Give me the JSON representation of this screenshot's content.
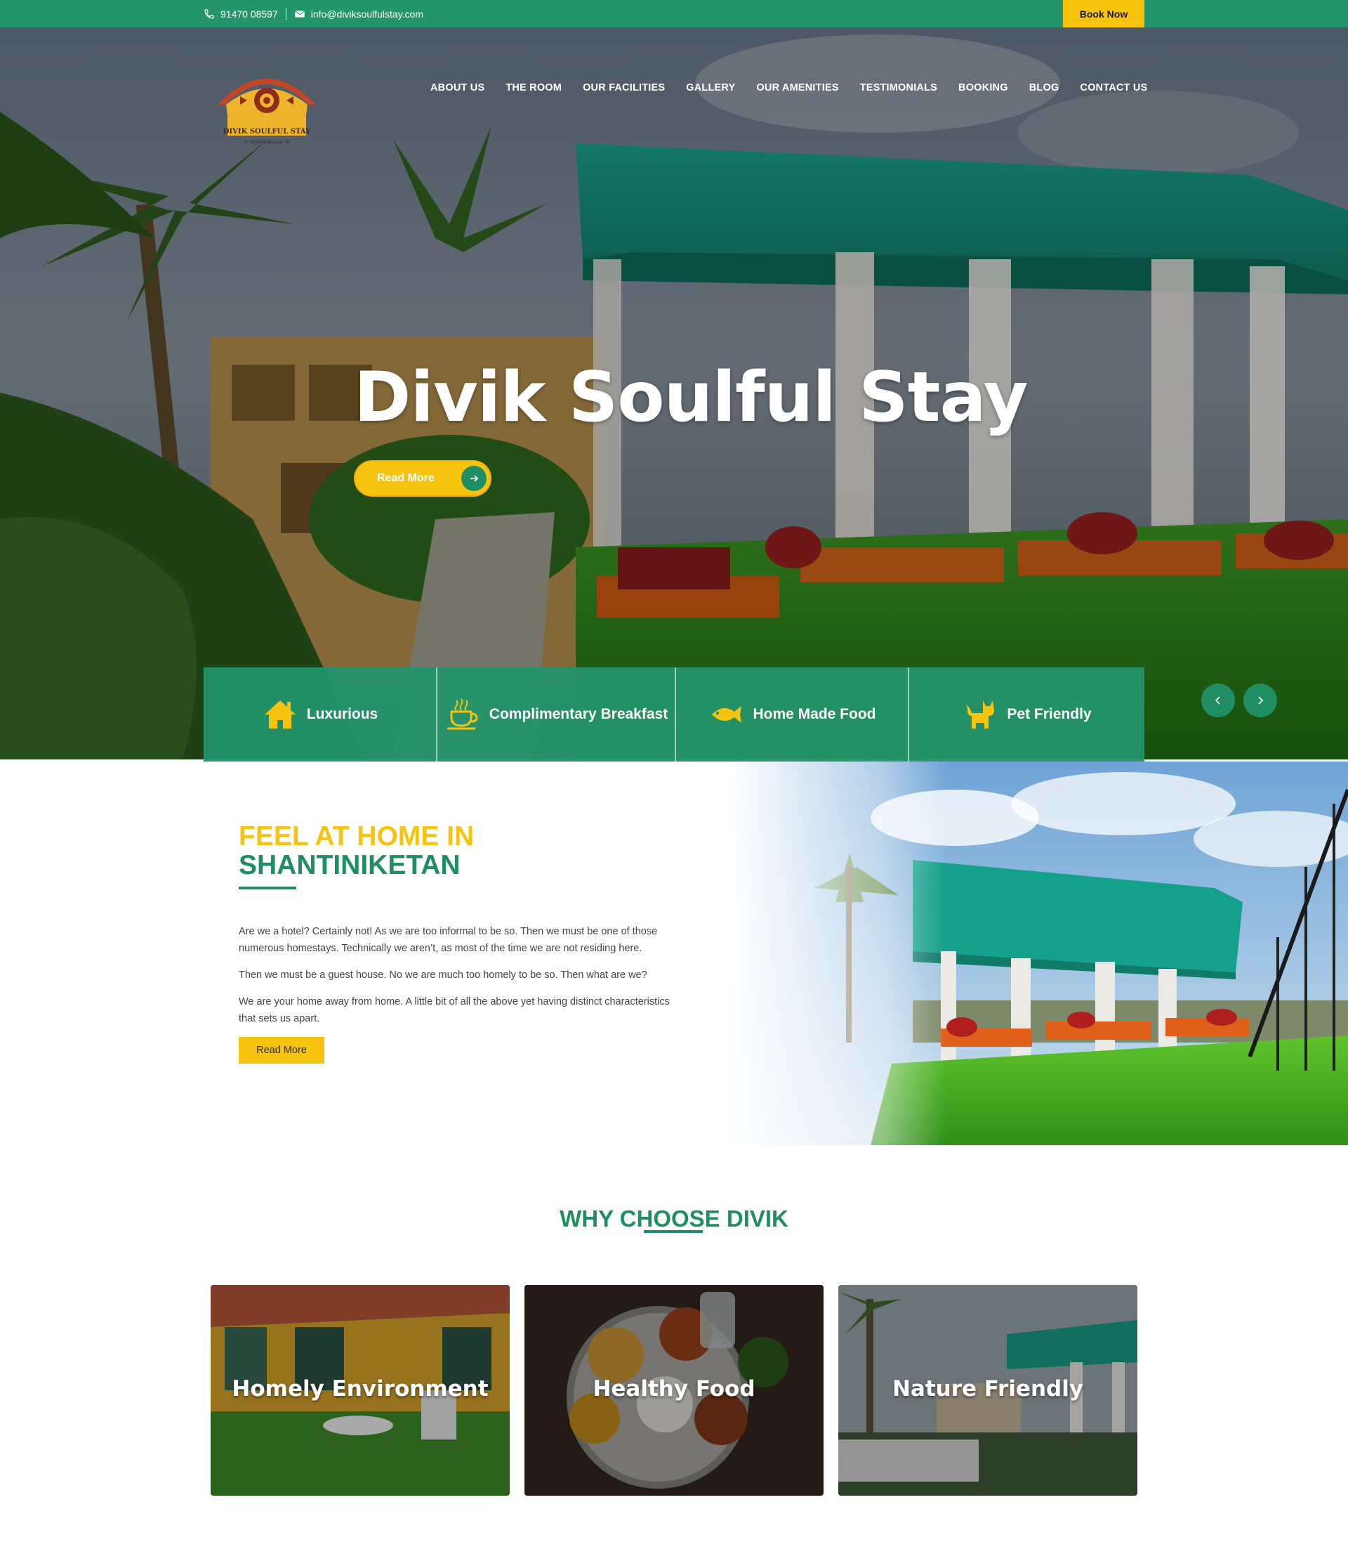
{
  "topbar": {
    "phone": "91470 08597",
    "email": "info@diviksoulfulstay.com",
    "book_label": "Book Now"
  },
  "logo": {
    "name": "DIVIK SOULFUL STAY",
    "tagline": "© Shantiniketan, W"
  },
  "nav": {
    "items": [
      "ABOUT US",
      "THE ROOM",
      "OUR FACILITIES",
      "GALLERY",
      "OUR AMENITIES",
      "TESTIMONIALS",
      "BOOKING",
      "BLOG",
      "CONTACT US"
    ]
  },
  "hero": {
    "title": "Divik Soulful Stay",
    "button_label": "Read More"
  },
  "features": [
    {
      "label": "Luxurious",
      "icon": "house-icon"
    },
    {
      "label": "Complimentary Breakfast",
      "icon": "coffee-cup-icon"
    },
    {
      "label": "Home Made Food",
      "icon": "fish-icon"
    },
    {
      "label": "Pet Friendly",
      "icon": "cat-icon"
    }
  ],
  "about": {
    "heading_line1": "FEEL AT HOME IN",
    "heading_line2": "SHANTINIKETAN",
    "paragraphs": [
      "Are we a hotel? Certainly not! As we are too informal to be so. Then we must be one of those numerous homestays. Technically we aren’t, as most of the time we are not residing here.",
      "Then we must be a guest house. No we are much too homely to be so. Then what are we?",
      "We are your home away from home. A little bit of all the above yet having distinct characteristics that sets us apart."
    ],
    "button_label": "Read More"
  },
  "why": {
    "title": "WHY CHOOSE DIVIK",
    "cards": [
      {
        "label": "Homely Environment"
      },
      {
        "label": "Healthy Food"
      },
      {
        "label": "Nature Friendly"
      }
    ]
  },
  "colors": {
    "brand_green": "#24946a",
    "accent_yellow": "#f6c40f"
  }
}
